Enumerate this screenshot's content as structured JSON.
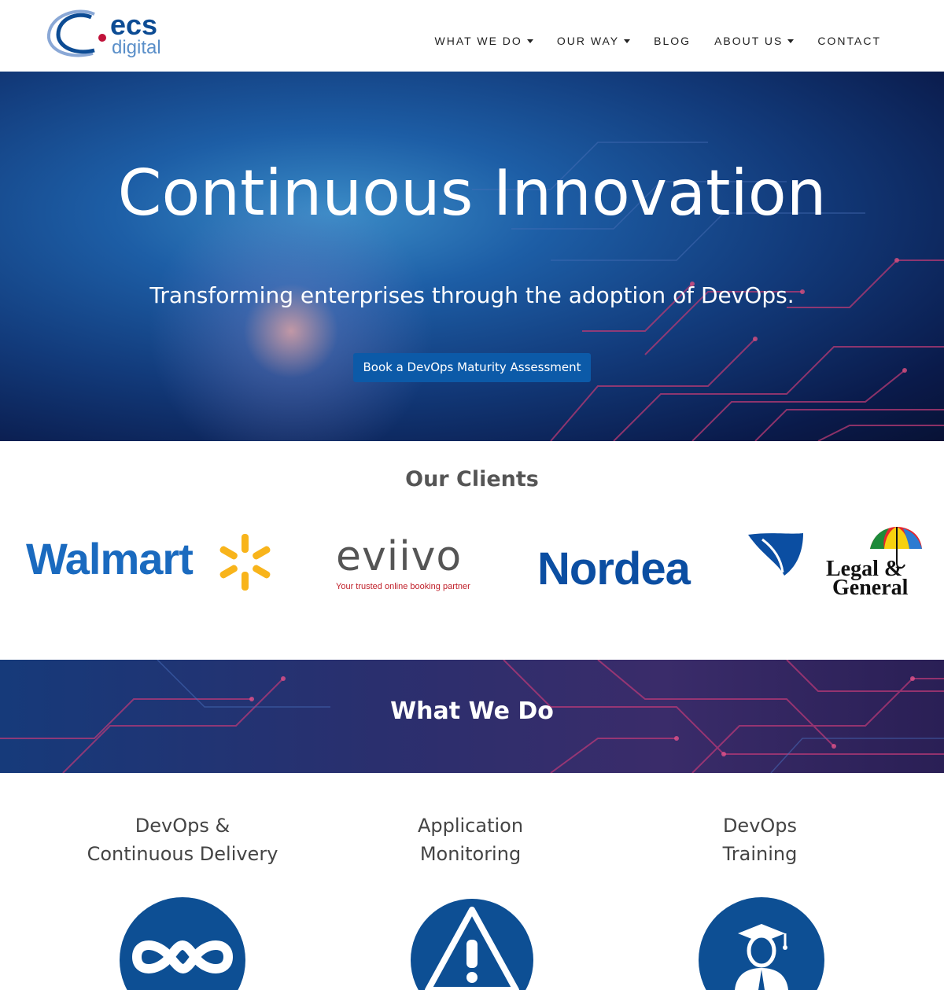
{
  "header": {
    "logo": {
      "word1": "ecs",
      "word2": "digital"
    },
    "nav": [
      {
        "label": "WHAT WE DO",
        "has_dropdown": true
      },
      {
        "label": "OUR WAY",
        "has_dropdown": true
      },
      {
        "label": "BLOG",
        "has_dropdown": false
      },
      {
        "label": "ABOUT US",
        "has_dropdown": true
      },
      {
        "label": "CONTACT",
        "has_dropdown": false
      }
    ]
  },
  "hero": {
    "title": "Continuous Innovation",
    "subtitle": "Transforming enterprises through the adoption of DevOps.",
    "cta_label": "Book a DevOps Maturity Assessment"
  },
  "clients": {
    "title": "Our Clients",
    "logos": [
      {
        "name": "Walmart",
        "text": "Walmart"
      },
      {
        "name": "eviivo",
        "text": "eviivo",
        "tagline": "Your trusted online booking partner"
      },
      {
        "name": "Nordea",
        "text": "Nordea"
      },
      {
        "name": "Legal & General",
        "line1": "Legal &",
        "line2": "General"
      }
    ]
  },
  "what_we_do": {
    "title": "What We Do",
    "services": [
      {
        "line1": "DevOps &",
        "line2": "Continuous Delivery",
        "icon": "infinity-icon"
      },
      {
        "line1": "Application",
        "line2": "Monitoring",
        "icon": "warning-icon"
      },
      {
        "line1": "DevOps",
        "line2": "Training",
        "icon": "graduate-icon"
      }
    ]
  },
  "colors": {
    "brand_blue": "#0d4c94",
    "cta_blue": "#0c5aa8",
    "icon_blue": "#0d4f94",
    "logo_red": "#c0123a"
  }
}
